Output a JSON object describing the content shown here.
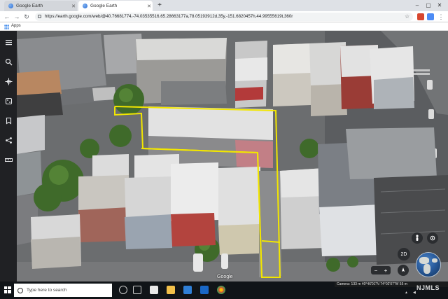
{
  "browser": {
    "tabs": [
      {
        "title": "Google Earth",
        "active": false
      },
      {
        "title": "Google Earth",
        "active": true
      }
    ],
    "new_tab": "+",
    "url": "https://earth.google.com/web/@40.76681774,-74.03535516,65.28663177a,78.05193912d,35y,-151.6820457h,44.99555619t,360r",
    "bookmarks_apps_label": "Apps",
    "window_controls": {
      "minimize": "–",
      "maximize": "▢",
      "close": "✕"
    }
  },
  "earth_toolbar": {
    "icons": [
      "menu-icon",
      "search-icon",
      "voyager-icon",
      "feeling-lucky-icon",
      "projects-icon",
      "share-icon",
      "measure-icon"
    ]
  },
  "map_controls": {
    "view_toggle": "2D",
    "zoom_out": "−",
    "zoom_in": "+",
    "google_logo": "Google",
    "status": "Camera: 133 m  40°46'01\"N 74°02'07\"W  55 m"
  },
  "watermark": "NJMLS",
  "taskbar": {
    "search_placeholder": "Type here to search"
  },
  "colors": {
    "parcel_outline": "#f2e600",
    "taskbar": "#101418",
    "earth_toolbar": "#202124"
  }
}
